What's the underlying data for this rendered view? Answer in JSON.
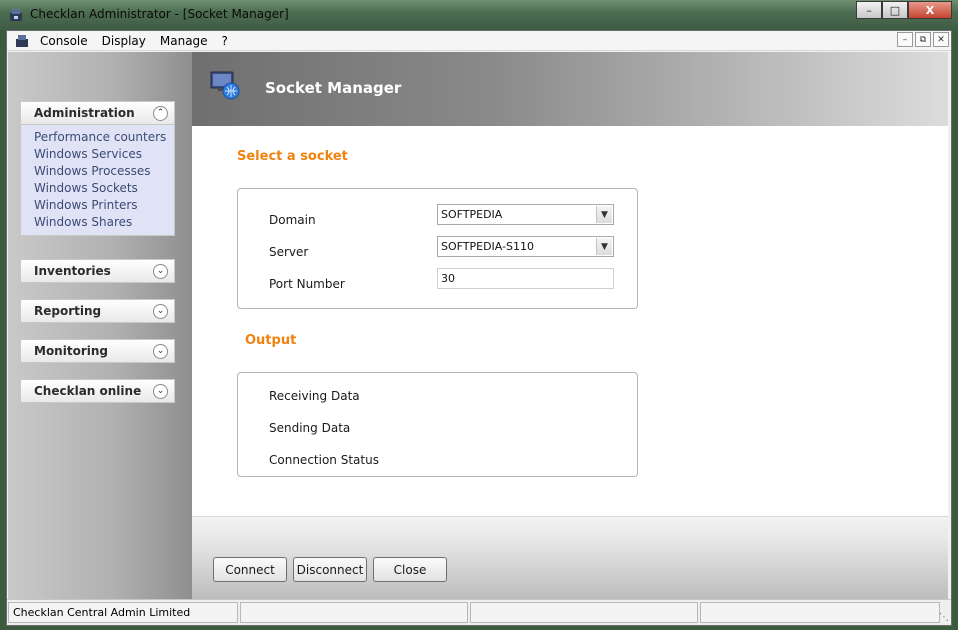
{
  "window": {
    "title": "Checklan Administrator - [Socket Manager]",
    "minimize_label": "–",
    "maximize_label": "□",
    "close_label": "X"
  },
  "menu": {
    "items": [
      "Console",
      "Display",
      "Manage",
      "?"
    ]
  },
  "sidebar": {
    "panels": [
      {
        "title": "Administration",
        "expanded": true,
        "links": [
          "Performance counters",
          "Windows Services",
          "Windows Processes",
          "Windows Sockets",
          "Windows Printers",
          "Windows Shares"
        ]
      },
      {
        "title": "Inventories",
        "expanded": false
      },
      {
        "title": "Reporting",
        "expanded": false
      },
      {
        "title": "Monitoring",
        "expanded": false
      },
      {
        "title": "Checklan online",
        "expanded": false
      }
    ]
  },
  "main": {
    "header_title": "Socket Manager",
    "select_section": {
      "title": "Select a socket",
      "domain_label": "Domain",
      "domain_value": "SOFTPEDIA",
      "server_label": "Server",
      "server_value": "SOFTPEDIA-S110",
      "port_label": "Port Number",
      "port_value": "30"
    },
    "output_section": {
      "title": "Output",
      "receiving_label": "Receiving Data",
      "sending_label": "Sending Data",
      "status_label": "Connection Status"
    },
    "buttons": {
      "connect": "Connect",
      "disconnect": "Disconnect",
      "close": "Close"
    }
  },
  "statusbar": {
    "cell1": "Checklan Central Admin Limited",
    "cell2": "",
    "cell3": "",
    "cell4": ""
  },
  "colors": {
    "section_title": "#f0820f",
    "sidebar_link": "#3c4a76",
    "panel_body_bg": "#dfe3f5"
  }
}
